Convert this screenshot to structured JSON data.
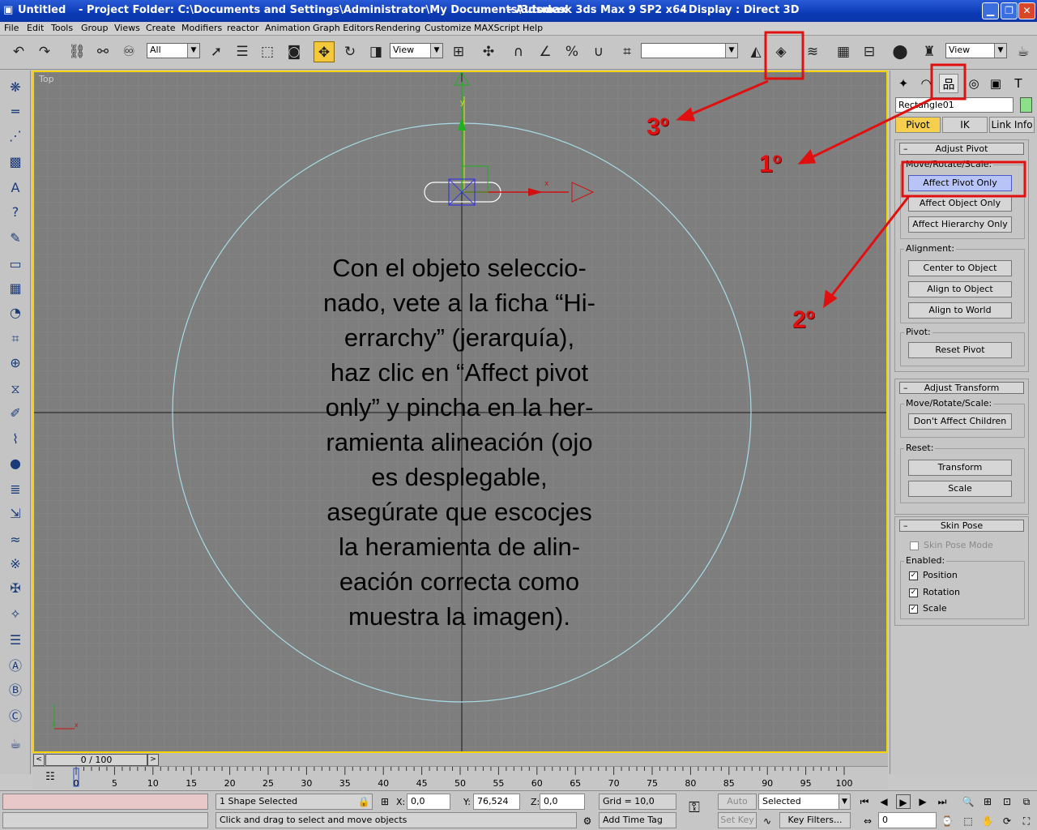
{
  "window": {
    "app_title": "Untitled",
    "project_folder": "- Project Folder: C:\\Documents and Settings\\Administrator\\My Documents\\3dsmax",
    "product": "- Autodesk 3ds Max 9 SP2 x64",
    "display": "- Display : Direct 3D"
  },
  "menu": [
    "File",
    "Edit",
    "Tools",
    "Group",
    "Views",
    "Create",
    "Modifiers",
    "reactor",
    "Animation",
    "Graph Editors",
    "Rendering",
    "Customize",
    "MAXScript",
    "Help"
  ],
  "toolbar": {
    "selection_filter": "All",
    "ref_coord": "View",
    "named_selection": "",
    "render_view": "View"
  },
  "viewport": {
    "label": "Top",
    "instruction": "Con el objeto seleccio-\nnado, vete a la ficha “Hi-\nerrarchy” (jerarquía),\nhaz clic en “Affect pivot\nonly” y pincha en la her-\nramienta alineación (ojo\nes desplegable,\nasegúrate que escocjes\nla heramienta de alin-\neación correcta como\nmuestra la imagen).",
    "gizmo_y": "y",
    "gizmo_x": "x",
    "axis_z": "z",
    "axis_x": "x",
    "shape_color": "#a8dbe6",
    "grid_color": "#8a8a8a"
  },
  "command_panel": {
    "object_name": "Rectangle01",
    "object_color": "#8ce08a",
    "tabs": {
      "pivot": "Pivot",
      "ik": "IK",
      "link_info": "Link Info"
    },
    "adjust_pivot": {
      "title": "Adjust Pivot",
      "move_group": "Move/Rotate/Scale:",
      "affect_pivot_only": "Affect Pivot Only",
      "affect_object_only": "Affect Object Only",
      "affect_hierarchy_only": "Affect Hierarchy Only",
      "alignment_group": "Alignment:",
      "center_to_object": "Center to Object",
      "align_to_object": "Align to Object",
      "align_to_world": "Align to World",
      "pivot_group": "Pivot:",
      "reset_pivot": "Reset Pivot"
    },
    "adjust_transform": {
      "title": "Adjust Transform",
      "move_group": "Move/Rotate/Scale:",
      "dont_affect_children": "Don't Affect Children",
      "reset_group": "Reset:",
      "transform": "Transform",
      "scale": "Scale"
    },
    "skin_pose": {
      "title": "Skin Pose",
      "skin_pose_mode": "Skin Pose Mode",
      "enabled_group": "Enabled:",
      "position": "Position",
      "rotation": "Rotation",
      "scale": "Scale"
    }
  },
  "timeline": {
    "frame_display": "0 / 100",
    "ticks": [
      "0",
      "5",
      "10",
      "15",
      "20",
      "25",
      "30",
      "35",
      "40",
      "45",
      "50",
      "55",
      "60",
      "65",
      "70",
      "75",
      "80",
      "85",
      "90",
      "95",
      "100"
    ]
  },
  "status": {
    "selection": "1 Shape Selected",
    "prompt": "Click and drag to select and move objects",
    "x_label": "X:",
    "x_value": "0,0",
    "y_label": "Y:",
    "y_value": "76,524",
    "z_label": "Z:",
    "z_value": "0,0",
    "grid": "Grid = 10,0",
    "add_time_tag": "Add Time Tag",
    "auto_key": "Auto Key",
    "set_key": "Set Key",
    "key_mode": "Selected",
    "key_filters": "Key Filters...",
    "current_frame": "0"
  },
  "annotations": {
    "step1": "1º",
    "step2": "2º",
    "step3": "3º",
    "color": "#e01010"
  }
}
